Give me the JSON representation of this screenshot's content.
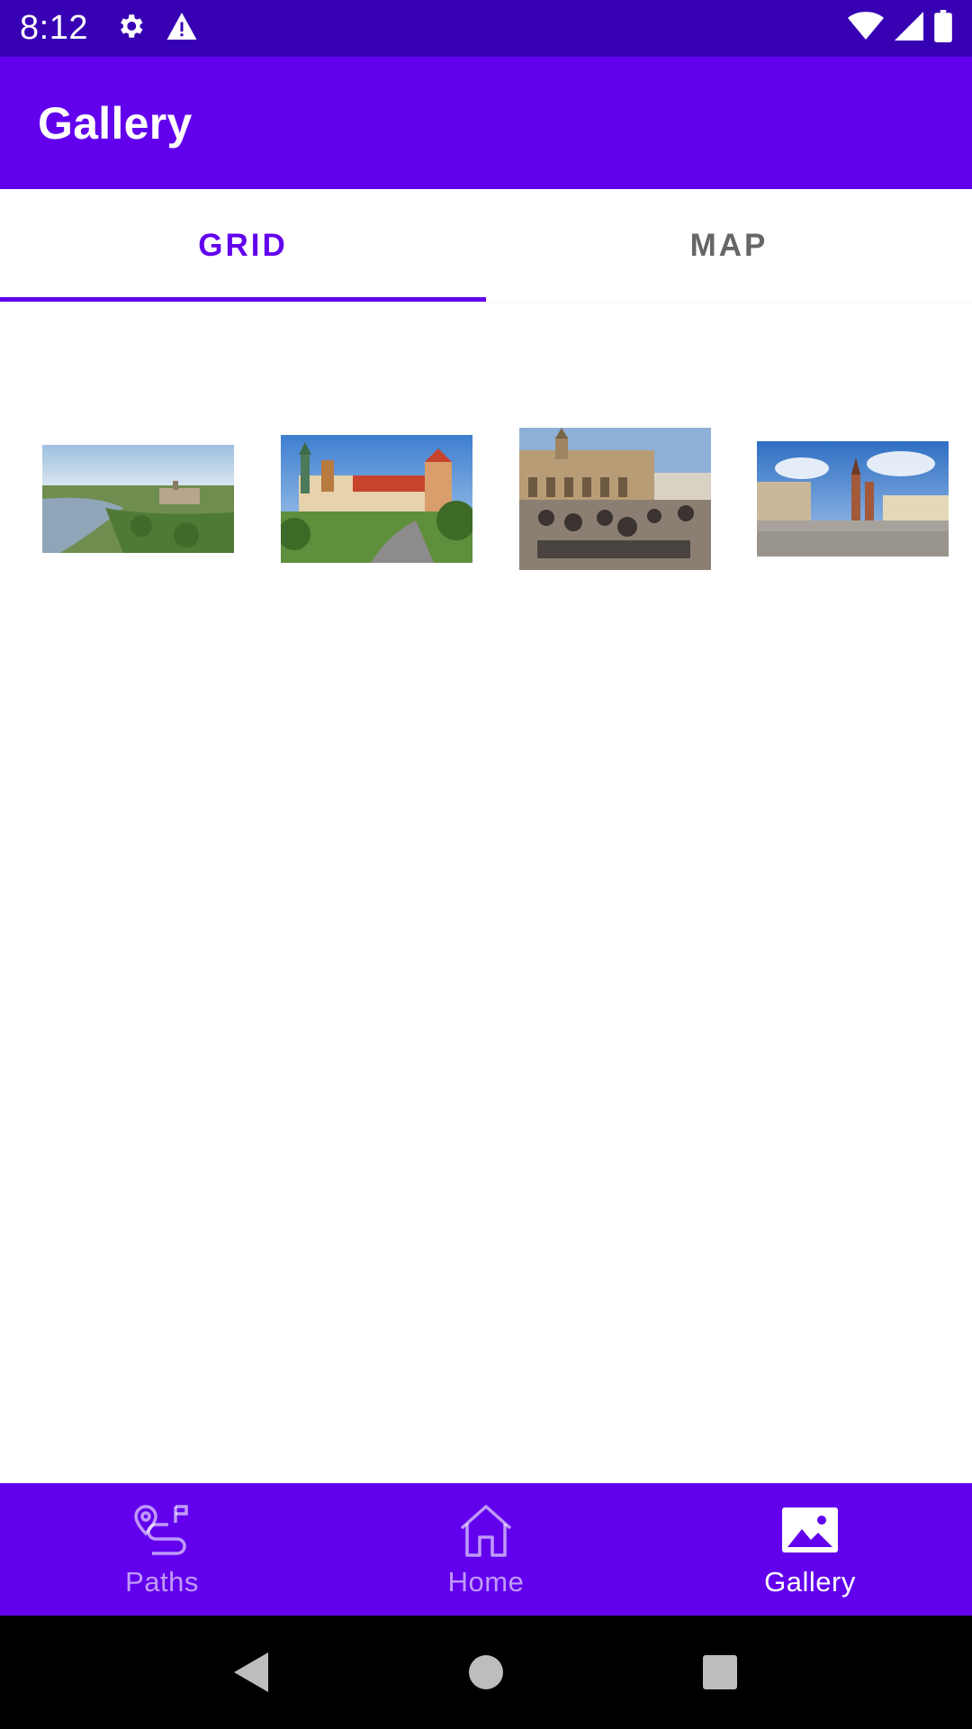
{
  "status_bar": {
    "time": "8:12",
    "icons_left": [
      "gear-icon",
      "warning-icon"
    ],
    "icons_right": [
      "wifi-icon",
      "signal-icon",
      "battery-icon"
    ]
  },
  "app_bar": {
    "title": "Gallery",
    "color": "#6200EE"
  },
  "tabs": [
    {
      "label": "GRID",
      "active": true
    },
    {
      "label": "MAP",
      "active": false
    }
  ],
  "gallery": {
    "images": [
      {
        "name": "krakow-river-aerial",
        "depicts": "aerial view of river and castle"
      },
      {
        "name": "wawel-castle",
        "depicts": "castle with red roofs"
      },
      {
        "name": "cloth-hall-crowd",
        "depicts": "crowded market square"
      },
      {
        "name": "main-market-square",
        "depicts": "market square with church towers"
      }
    ]
  },
  "bottom_nav": {
    "items": [
      {
        "label": "Paths",
        "icon": "route-icon",
        "active": false
      },
      {
        "label": "Home",
        "icon": "home-icon",
        "active": false
      },
      {
        "label": "Gallery",
        "icon": "image-icon",
        "active": true
      }
    ]
  },
  "system_nav": {
    "icons": [
      "back-icon",
      "home-circle-icon",
      "recents-icon"
    ]
  },
  "colors": {
    "primary": "#6200EE",
    "primary_dark": "#3700B3",
    "tab_inactive": "#666666"
  }
}
